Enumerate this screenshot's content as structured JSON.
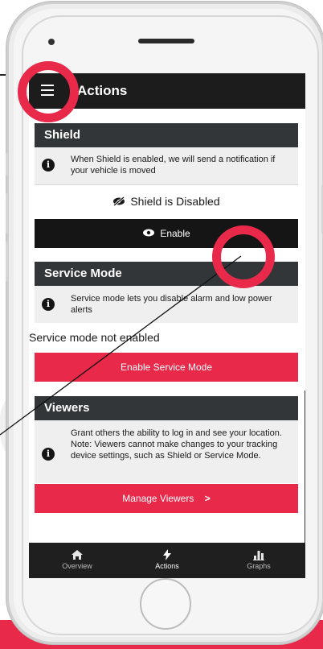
{
  "colors": {
    "accent": "#e8294a",
    "dark": "#1c1c1c",
    "card_header": "#323638",
    "card_body": "#efefef"
  },
  "appbar": {
    "title": "Actions",
    "menu_icon": "hamburger-menu-icon"
  },
  "shield": {
    "title": "Shield",
    "info": "When Shield is enabled, we will send a notification if your vehicle is moved",
    "status": "Shield is Disabled",
    "status_icon": "eye-slash-icon",
    "button_label": "Enable",
    "button_icon": "eye-icon"
  },
  "service_mode": {
    "title": "Service Mode",
    "info": "Service mode lets you disable alarm and low power alerts",
    "status": "Service mode not enabled",
    "button_label": "Enable Service Mode"
  },
  "viewers": {
    "title": "Viewers",
    "info": "Grant others the ability to log in and see your location. Note: Viewers cannot make changes to your tracking device settings, such as Shield or Service Mode.",
    "button_label": "Manage Viewers",
    "button_chevron": ">"
  },
  "bottom_nav": {
    "items": [
      {
        "label": "Overview",
        "icon": "home-icon",
        "active": false
      },
      {
        "label": "Actions",
        "icon": "lightning-bolt-icon",
        "active": true
      },
      {
        "label": "Graphs",
        "icon": "bar-chart-icon",
        "active": false
      }
    ]
  },
  "info_glyph": "i"
}
